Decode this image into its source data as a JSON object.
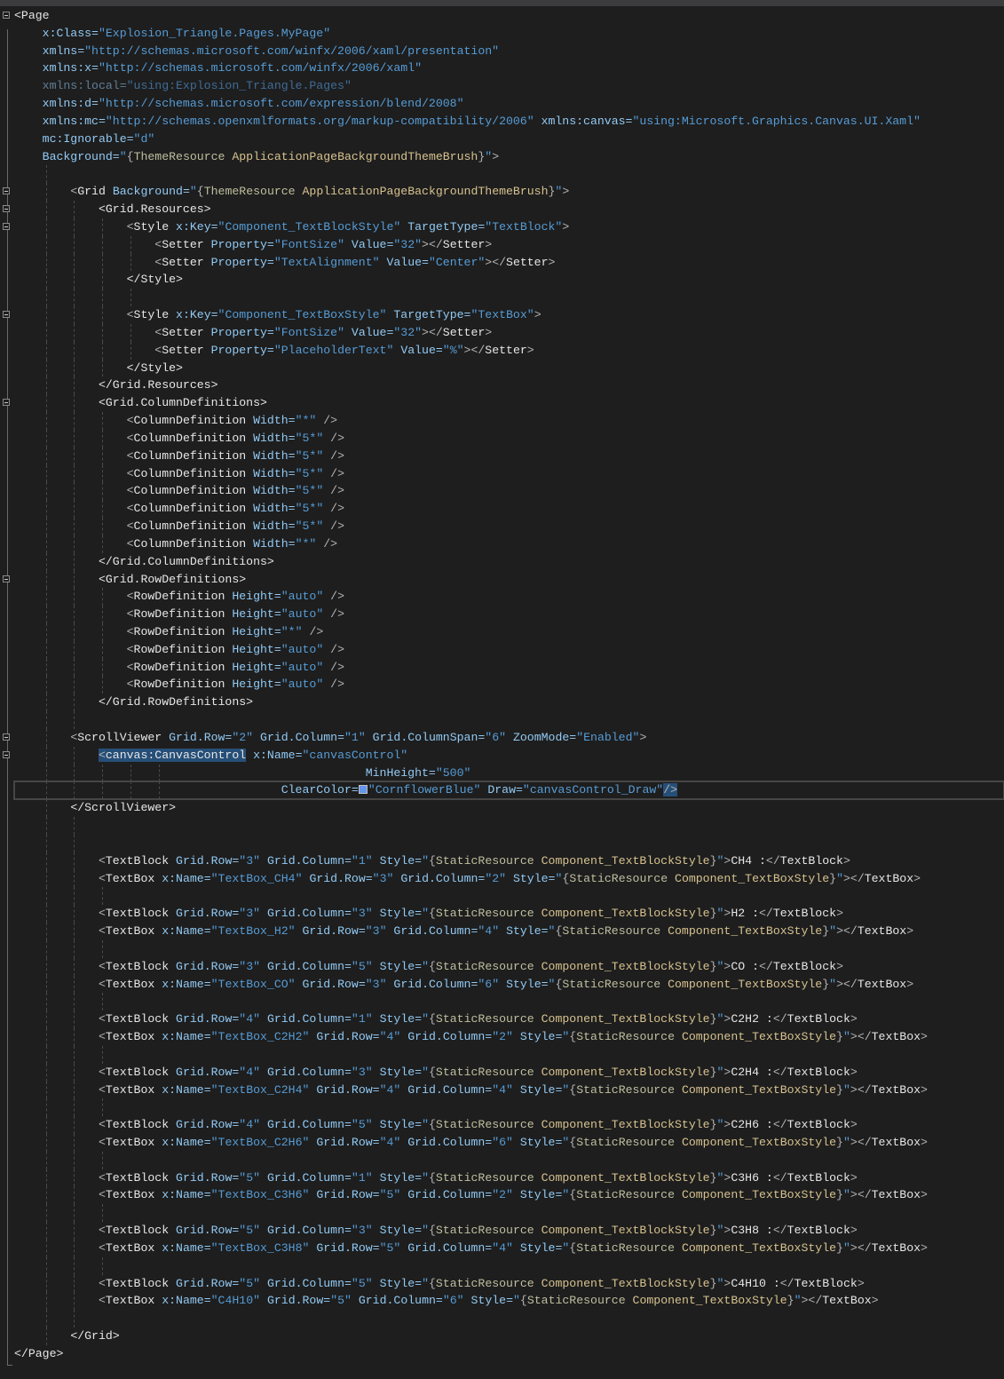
{
  "editor": {
    "language": "XAML",
    "colors": {
      "background": "#1e1e1e",
      "selection": "#264f78",
      "swatch": "#6495ed"
    },
    "lines": [
      "<Page",
      "    x:Class=\"Explosion_Triangle.Pages.MyPage\"",
      "    xmlns=\"http://schemas.microsoft.com/winfx/2006/xaml/presentation\"",
      "    xmlns:x=\"http://schemas.microsoft.com/winfx/2006/xaml\"",
      "    xmlns:local=\"using:Explosion_Triangle.Pages\"",
      "    xmlns:d=\"http://schemas.microsoft.com/expression/blend/2008\"",
      "    xmlns:mc=\"http://schemas.openxmlformats.org/markup-compatibility/2006\" xmlns:canvas=\"using:Microsoft.Graphics.Canvas.UI.Xaml\"",
      "    mc:Ignorable=\"d\"",
      "    Background=\"{ThemeResource ApplicationPageBackgroundThemeBrush}\">",
      "",
      "        <Grid Background=\"{ThemeResource ApplicationPageBackgroundThemeBrush}\">",
      "            <Grid.Resources>",
      "                <Style x:Key=\"Component_TextBlockStyle\" TargetType=\"TextBlock\">",
      "                    <Setter Property=\"FontSize\" Value=\"32\"></Setter>",
      "                    <Setter Property=\"TextAlignment\" Value=\"Center\"></Setter>",
      "                </Style>",
      "",
      "                <Style x:Key=\"Component_TextBoxStyle\" TargetType=\"TextBox\">",
      "                    <Setter Property=\"FontSize\" Value=\"32\"></Setter>",
      "                    <Setter Property=\"PlaceholderText\" Value=\"%\"></Setter>",
      "                </Style>",
      "            </Grid.Resources>",
      "            <Grid.ColumnDefinitions>",
      "                <ColumnDefinition Width=\"*\" />",
      "                <ColumnDefinition Width=\"5*\" />",
      "                <ColumnDefinition Width=\"5*\" />",
      "                <ColumnDefinition Width=\"5*\" />",
      "                <ColumnDefinition Width=\"5*\" />",
      "                <ColumnDefinition Width=\"5*\" />",
      "                <ColumnDefinition Width=\"5*\" />",
      "                <ColumnDefinition Width=\"*\" />",
      "            </Grid.ColumnDefinitions>",
      "            <Grid.RowDefinitions>",
      "                <RowDefinition Height=\"auto\" />",
      "                <RowDefinition Height=\"auto\" />",
      "                <RowDefinition Height=\"*\" />",
      "                <RowDefinition Height=\"auto\" />",
      "                <RowDefinition Height=\"auto\" />",
      "                <RowDefinition Height=\"auto\" />",
      "            </Grid.RowDefinitions>",
      "",
      "        <ScrollViewer Grid.Row=\"2\" Grid.Column=\"1\" Grid.ColumnSpan=\"6\" ZoomMode=\"Enabled\">",
      "            <canvas:CanvasControl x:Name=\"canvasControl\"",
      "                                                  MinHeight=\"500\"",
      "                                      ClearColor=\"CornflowerBlue\" Draw=\"canvasControl_Draw\"/>",
      "        </ScrollViewer>",
      "",
      "",
      "            <TextBlock Grid.Row=\"3\" Grid.Column=\"1\" Style=\"{StaticResource Component_TextBlockStyle}\">CH4 :</TextBlock>",
      "            <TextBox x:Name=\"TextBox_CH4\" Grid.Row=\"3\" Grid.Column=\"2\" Style=\"{StaticResource Component_TextBoxStyle}\"></TextBox>",
      "",
      "            <TextBlock Grid.Row=\"3\" Grid.Column=\"3\" Style=\"{StaticResource Component_TextBlockStyle}\">H2 :</TextBlock>",
      "            <TextBox x:Name=\"TextBox_H2\" Grid.Row=\"3\" Grid.Column=\"4\" Style=\"{StaticResource Component_TextBoxStyle}\"></TextBox>",
      "",
      "            <TextBlock Grid.Row=\"3\" Grid.Column=\"5\" Style=\"{StaticResource Component_TextBlockStyle}\">CO :</TextBlock>",
      "            <TextBox x:Name=\"TextBox_CO\" Grid.Row=\"3\" Grid.Column=\"6\" Style=\"{StaticResource Component_TextBoxStyle}\"></TextBox>",
      "",
      "            <TextBlock Grid.Row=\"4\" Grid.Column=\"1\" Style=\"{StaticResource Component_TextBlockStyle}\">C2H2 :</TextBlock>",
      "            <TextBox x:Name=\"TextBox_C2H2\" Grid.Row=\"4\" Grid.Column=\"2\" Style=\"{StaticResource Component_TextBoxStyle}\"></TextBox>",
      "",
      "            <TextBlock Grid.Row=\"4\" Grid.Column=\"3\" Style=\"{StaticResource Component_TextBlockStyle}\">C2H4 :</TextBlock>",
      "            <TextBox x:Name=\"TextBox_C2H4\" Grid.Row=\"4\" Grid.Column=\"4\" Style=\"{StaticResource Component_TextBoxStyle}\"></TextBox>",
      "",
      "            <TextBlock Grid.Row=\"4\" Grid.Column=\"5\" Style=\"{StaticResource Component_TextBlockStyle}\">C2H6 :</TextBlock>",
      "            <TextBox x:Name=\"TextBox_C2H6\" Grid.Row=\"4\" Grid.Column=\"6\" Style=\"{StaticResource Component_TextBoxStyle}\"></TextBox>",
      "",
      "            <TextBlock Grid.Row=\"5\" Grid.Column=\"1\" Style=\"{StaticResource Component_TextBlockStyle}\">C3H6 :</TextBlock>",
      "            <TextBox x:Name=\"TextBox_C3H6\" Grid.Row=\"5\" Grid.Column=\"2\" Style=\"{StaticResource Component_TextBoxStyle}\"></TextBox>",
      "",
      "            <TextBlock Grid.Row=\"5\" Grid.Column=\"3\" Style=\"{StaticResource Component_TextBlockStyle}\">C3H8 :</TextBlock>",
      "            <TextBox x:Name=\"TextBox_C3H8\" Grid.Row=\"5\" Grid.Column=\"4\" Style=\"{StaticResource Component_TextBoxStyle}\"></TextBox>",
      "",
      "            <TextBlock Grid.Row=\"5\" Grid.Column=\"5\" Style=\"{StaticResource Component_TextBlockStyle}\">C4H10 :</TextBlock>",
      "            <TextBox x:Name=\"C4H10\" Grid.Row=\"5\" Grid.Column=\"6\" Style=\"{StaticResource Component_TextBoxStyle}\"></TextBox>",
      "",
      "        </Grid>",
      "</Page>"
    ]
  }
}
